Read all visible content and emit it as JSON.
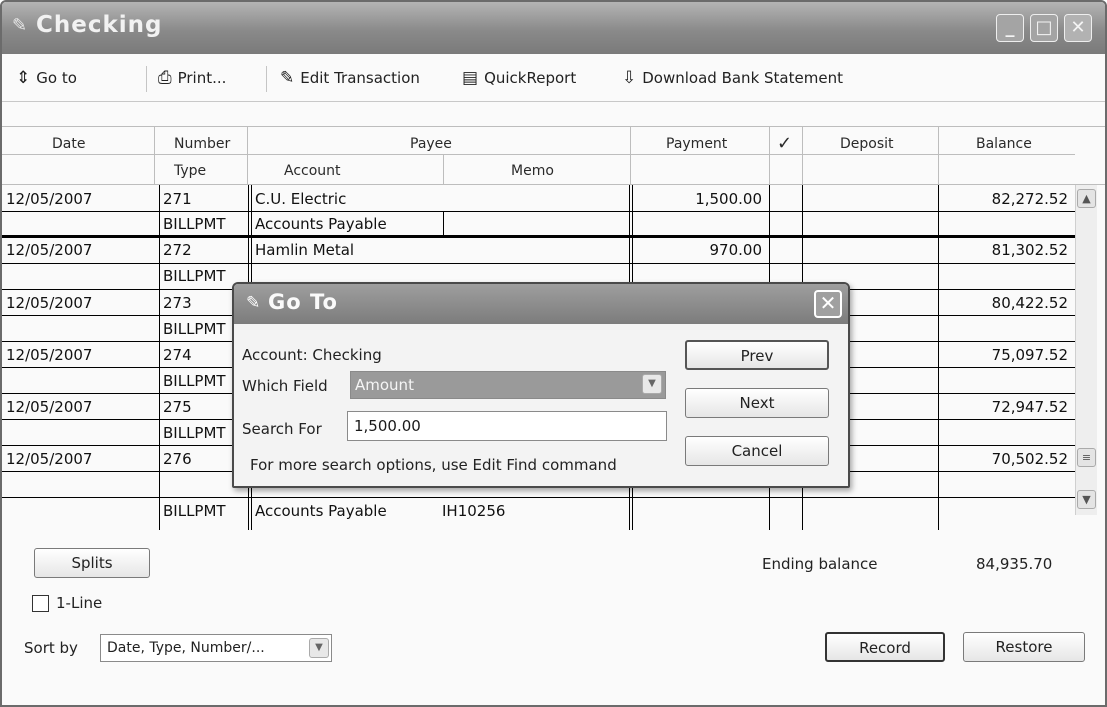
{
  "window": {
    "title": "Checking"
  },
  "toolbar": {
    "goto": "Go to",
    "print": "Print...",
    "edit_transaction": "Edit Transaction",
    "quickreport": "QuickReport",
    "download": "Download Bank Statement"
  },
  "columns": {
    "date": "Date",
    "number": "Number",
    "payee": "Payee",
    "payment": "Payment",
    "check": "✓",
    "deposit": "Deposit",
    "balance": "Balance",
    "type": "Type",
    "account": "Account",
    "memo": "Memo"
  },
  "rows": [
    {
      "date": "12/05/2007",
      "number": "271",
      "payee": "C.U. Electric",
      "payment": "1,500.00",
      "balance": "82,272.52",
      "type": "BILLPMT",
      "account": "Accounts Payable",
      "memo": ""
    },
    {
      "date": "12/05/2007",
      "number": "272",
      "payee": "Hamlin Metal",
      "payment": "970.00",
      "balance": "81,302.52",
      "type": "BILLPMT",
      "account": "",
      "memo": ""
    },
    {
      "date": "12/05/2007",
      "number": "273",
      "payee": "",
      "payment": "",
      "balance": "80,422.52",
      "type": "BILLPMT",
      "account": "",
      "memo": ""
    },
    {
      "date": "12/05/2007",
      "number": "274",
      "payee": "",
      "payment": "",
      "balance": "75,097.52",
      "type": "BILLPMT",
      "account": "",
      "memo": ""
    },
    {
      "date": "12/05/2007",
      "number": "275",
      "payee": "",
      "payment": "",
      "balance": "72,947.52",
      "type": "BILLPMT",
      "account": "",
      "memo": ""
    },
    {
      "date": "12/05/2007",
      "number": "276",
      "payee": "",
      "payment": "",
      "balance": "70,502.52",
      "type": "BILLPMT",
      "account": "Accounts Payable",
      "memo": "IH10256"
    }
  ],
  "footer": {
    "splits": "Splits",
    "one_line": "1-Line",
    "ending_balance_label": "Ending balance",
    "ending_balance": "84,935.70",
    "sort_by_label": "Sort by",
    "sort_by_value": "Date, Type, Number/...",
    "record": "Record",
    "restore": "Restore"
  },
  "dialog": {
    "title": "Go To",
    "account_label": "Account: Checking",
    "which_field_label": "Which Field",
    "which_field_value": "Amount",
    "search_for_label": "Search For",
    "search_for_value": "1,500.00",
    "hint": "For more search options, use Edit Find command",
    "prev": "Prev",
    "next": "Next",
    "cancel": "Cancel"
  }
}
